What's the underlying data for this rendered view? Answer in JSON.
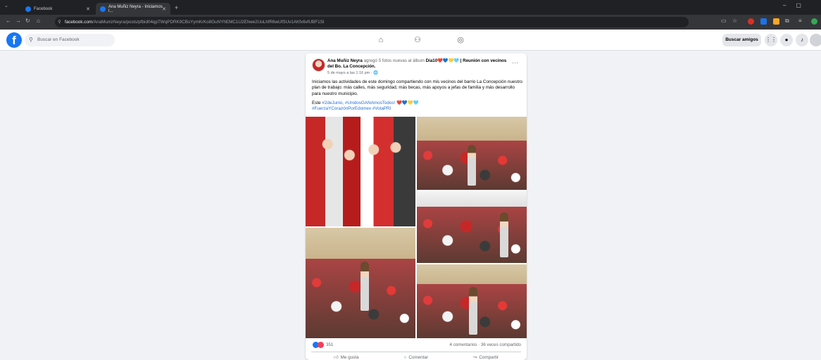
{
  "browser": {
    "tabs": [
      {
        "title": "Facebook"
      },
      {
        "title": "Ana Muñiz Neyra - Iniciamos l..."
      }
    ],
    "url_host": "facebook.com",
    "url_path": "/AnaMunizNeyra/posts/pfbid04qpTWqPDRK9CBsYymKrKo8GuNYhEMC1U2Ehwe2UoLhfR6wUfSUv1AKfx6vfUBF1Sl"
  },
  "header": {
    "logo": "f",
    "search_placeholder": "Buscar en Facebook",
    "find_friends": "Buscar amigos"
  },
  "post": {
    "author": "Ana Muñiz Neyra",
    "action": " agregó 5 fotos nuevas al álbum ",
    "album": "Día10❤️💙💛🩵 | Reunión con vecinos del Bo. La Concepción.",
    "date": "5 de mayo a las 1:16 pm · 🌐",
    "more": "···",
    "text": "Iniciamos las actividades de este domingo compartiendo con mis vecinos del barrio La Concepción nuestro plan de trabajo: más calles, más seguridad, más becas, más apoyos a jefas de familia y más desarrollo para nuestro municipio.",
    "tags_prefix": "Este ",
    "tags_line1": "#2deJunio, #UnidosGANAmosTodos!",
    "tags_emoji": " ❤️💙💛🩵",
    "tags_line2": "#FuerzaYCorazónPorEdomex #VotaPRI",
    "reactions_count": "351",
    "shares": "4 comentarios · 36 veces compartido",
    "like": "Me gusta",
    "comment": "Comentar",
    "share": "Compartir"
  },
  "colors": {
    "facebook_blue": "#1877f2",
    "hashtag": "#216fdb",
    "like_blue": "#1877f2",
    "love_red": "#f33e58"
  },
  "icons": [
    "home-icon",
    "friends-icon",
    "groups-icon",
    "menu-grid-icon",
    "messenger-icon",
    "bell-icon",
    "profile-avatar",
    "like-icon",
    "comment-icon",
    "share-icon"
  ]
}
